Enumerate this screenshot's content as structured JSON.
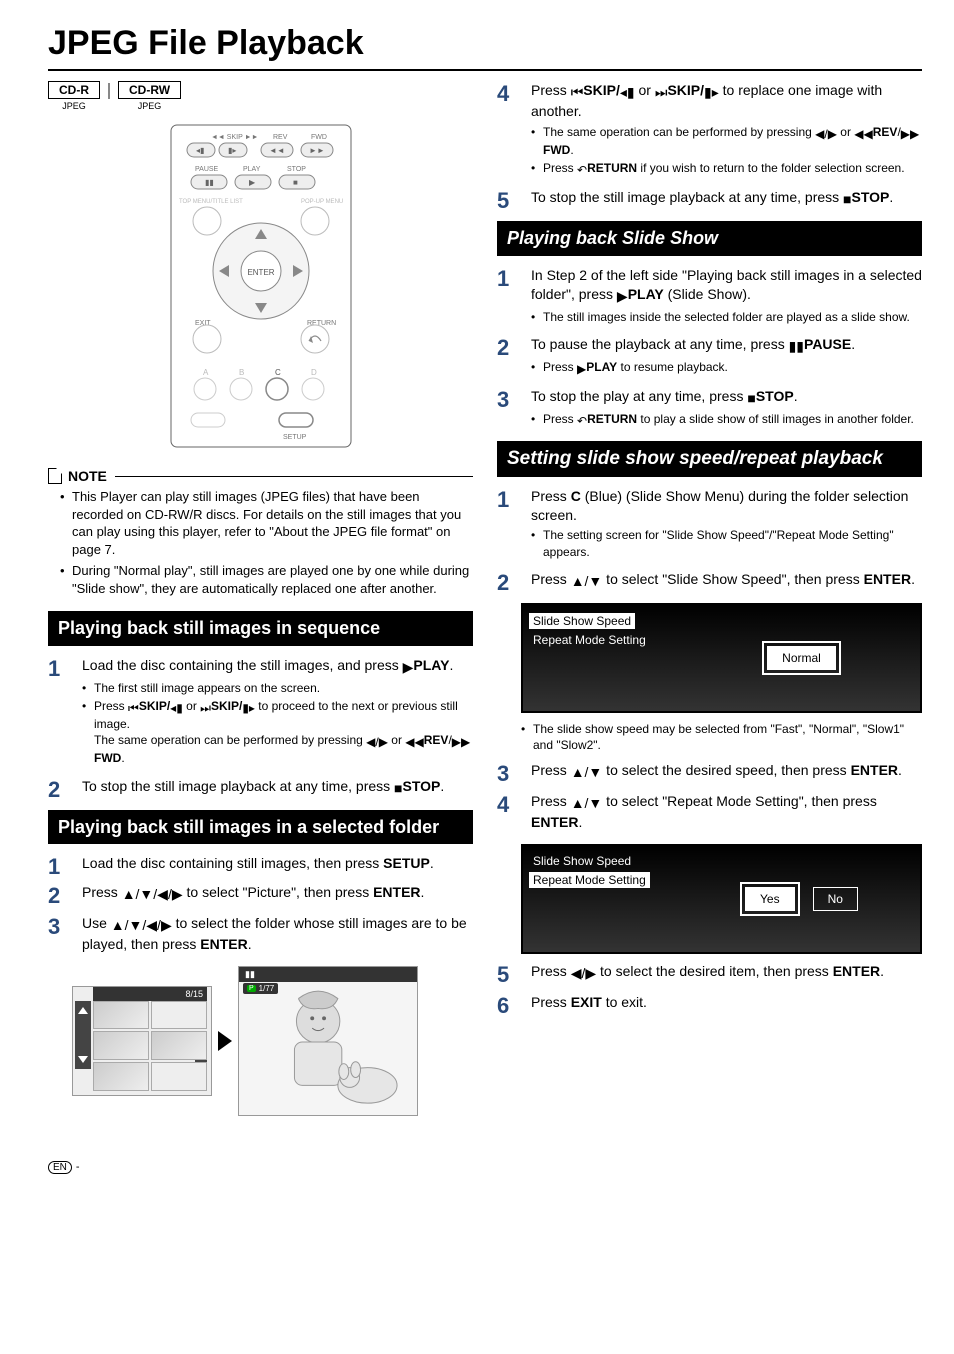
{
  "title": "JPEG File Playback",
  "badges": {
    "cdr": "CD-R",
    "cdrw": "CD-RW",
    "jpeg": "JPEG"
  },
  "noteLabel": "NOTE",
  "notes": [
    "This Player can play still images (JPEG files) that have been recorded on CD-RW/R discs. For details on the still images that you can play using this player, refer to \"About the JPEG file format\" on page 7.",
    "During \"Normal play\", still images are played one by one while during \"Slide show\", they are automatically replaced one after another."
  ],
  "sectA": {
    "title": "Playing back still images in sequence"
  },
  "sectA_steps": {
    "s1": {
      "pre": "Load the disc containing the still images, and press ",
      "btn": "PLAY",
      "post": ".",
      "sub1": "The first still image appears on the screen.",
      "sub2a": "Press ",
      "sub2_skip1": "SKIP/",
      "sub2_or": " or ",
      "sub2_skip2": "SKIP/",
      "sub2b": " to proceed to the next or previous still image.",
      "sub2c": "The same operation can be performed by pressing ",
      "sub2_lr_or": " or ",
      "sub2_rev": "REV",
      "sub2_slash": "/",
      "sub2_fwd": "FWD",
      "sub2_end": "."
    },
    "s2": {
      "pre": "To stop the still image playback at any time, press ",
      "btn": "STOP",
      "post": "."
    }
  },
  "sectB": {
    "title": "Playing back still images in a selected folder"
  },
  "sectB_steps": {
    "s1": {
      "pre": "Load the disc containing still images, then press ",
      "btn": "SETUP",
      "post": "."
    },
    "s2": {
      "pre": "Press ",
      "mid": " to select \"Picture\", then press ",
      "btn": "ENTER",
      "post": "."
    },
    "s3": {
      "pre": "Use ",
      "mid": " to select the folder whose still images are to be played, then press ",
      "btn": "ENTER",
      "post": "."
    }
  },
  "thumb": {
    "counter": "8/15",
    "detail_counter": "1/77"
  },
  "rightTop": {
    "s4": {
      "pre": "Press ",
      "skip1": "SKIP/",
      "or": " or ",
      "skip2": "SKIP/",
      "post": " to replace one image with another.",
      "sub1a": "The same operation can be performed by pressing ",
      "sub1_or": " or ",
      "sub1_rev": "REV",
      "sub1_slash": "/",
      "sub1_fwd": "FWD",
      "sub1_end": ".",
      "sub2a": "Press ",
      "sub2_ret": "RETURN",
      "sub2b": " if you wish to return to the folder selection screen."
    },
    "s5": {
      "pre": "To stop the still image playback at any time, press ",
      "btn": "STOP",
      "post": "."
    }
  },
  "sectC": {
    "title": "Playing back Slide Show"
  },
  "sectC_steps": {
    "s1": {
      "pre": "In Step 2 of the left side \"Playing back still images in a selected folder\", press ",
      "btn": "PLAY",
      "post": " (Slide Show).",
      "sub1": "The still images inside the selected folder are played as a slide show."
    },
    "s2": {
      "pre": "To pause the playback at any time, press ",
      "btn": "PAUSE",
      "post": ".",
      "sub1a": "Press ",
      "sub1_btn": "PLAY",
      "sub1b": " to resume playback."
    },
    "s3": {
      "pre": "To stop the play at any time, press ",
      "btn": "STOP",
      "post": ".",
      "sub1a": "Press ",
      "sub1_ret": "RETURN",
      "sub1b": " to play a slide show of still images in another folder."
    }
  },
  "sectD": {
    "title": "Setting slide show speed/repeat playback"
  },
  "sectD_steps": {
    "s1": {
      "pre": "Press ",
      "btn_c": "C",
      "post": " (Blue) (Slide Show Menu) during the folder selection screen.",
      "sub1": "The setting screen for \"Slide Show Speed\"/\"Repeat Mode Setting\" appears."
    },
    "s2": {
      "pre": "Press ",
      "mid": " to select \"Slide Show Speed\", then press ",
      "btn": "ENTER",
      "post": "."
    },
    "menu1": {
      "left1": "Slide Show Speed",
      "left2": "Repeat Mode Setting",
      "opt": "Normal"
    },
    "s2_sub": "The slide show speed may be selected from \"Fast\", \"Normal\", \"Slow1\" and \"Slow2\".",
    "s3": {
      "pre": "Press ",
      "mid": " to select the desired speed, then press ",
      "btn": "ENTER",
      "post": "."
    },
    "s4": {
      "pre": "Press ",
      "mid": " to select \"Repeat Mode Setting\", then press ",
      "btn": "ENTER",
      "post": "."
    },
    "menu2": {
      "left1": "Slide Show Speed",
      "left2": "Repeat Mode Setting",
      "yes": "Yes",
      "no": "No"
    },
    "s5": {
      "pre": "Press ",
      "mid": " to select the desired item, then press ",
      "btn": "ENTER",
      "post": "."
    },
    "s6": {
      "pre": "Press ",
      "btn": "EXIT",
      "post": " to exit."
    }
  },
  "foot": {
    "en": "EN",
    "dash": "-"
  }
}
